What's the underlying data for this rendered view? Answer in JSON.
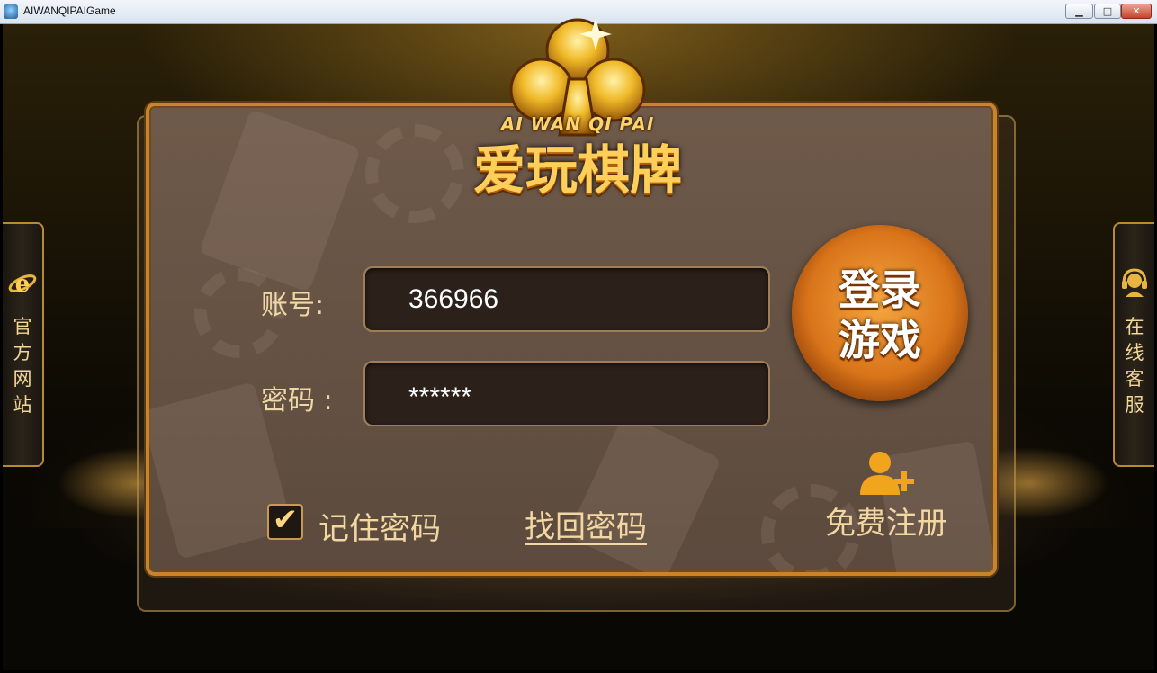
{
  "window": {
    "title": "AIWANQIPAIGame",
    "controls": {
      "minimize": "▁",
      "maximize": "□",
      "close": "✕"
    }
  },
  "side": {
    "left": {
      "icon": "ie-browser-icon",
      "label": [
        "官",
        "方",
        "网",
        "站"
      ]
    },
    "right": {
      "icon": "headset-icon",
      "label": [
        "在",
        "线",
        "客",
        "服"
      ]
    }
  },
  "logo": {
    "english": "AI WAN QI PAI",
    "chinese": "爱玩棋牌",
    "icon": "club-icon"
  },
  "form": {
    "account_label": "账号:",
    "account_value": "366966",
    "password_label": "密码 :",
    "password_value": "******",
    "login_button": [
      "登录",
      "游戏"
    ],
    "remember_checked": true,
    "remember_label": "记住密码",
    "forgot_link": "找回密码",
    "register_label": "免费注册",
    "register_icon": "add-user-icon"
  },
  "colors": {
    "accent_gold": "#c8842d",
    "label_text": "#f3d7a2",
    "login_orange": "#d9741a"
  }
}
